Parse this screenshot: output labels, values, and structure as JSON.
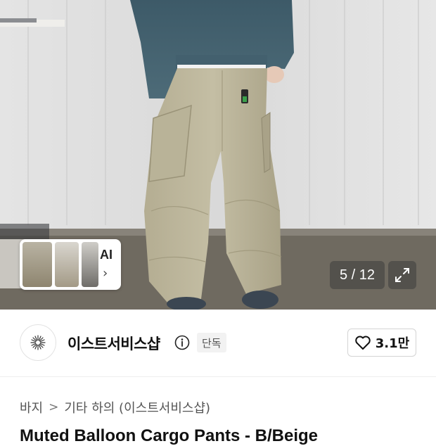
{
  "gallery": {
    "ai_label": "AI",
    "ai_chevron": "›",
    "counter": "5 / 12",
    "expand_icon": "expand-icon"
  },
  "shop": {
    "logo_icon": "shop-logo-icon",
    "name": "이스트서비스샵",
    "info_icon": "info-icon",
    "badge": "단독",
    "like_icon": "heart-icon",
    "like_count": "3.1만"
  },
  "breadcrumb": {
    "items": [
      "바지",
      "기타 하의 (이스트서비스샵)"
    ],
    "separator": ">"
  },
  "product": {
    "title": "Muted Balloon Cargo Pants - B/Beige"
  }
}
